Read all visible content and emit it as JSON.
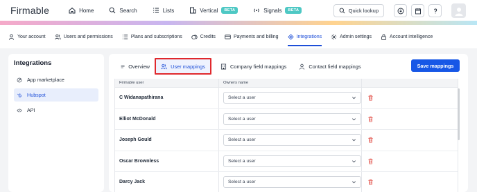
{
  "app": {
    "logo_text": "Firmable"
  },
  "topnav": {
    "items": [
      {
        "label": "Home",
        "icon": "home-icon"
      },
      {
        "label": "Search",
        "icon": "search-icon"
      },
      {
        "label": "Lists",
        "icon": "list-icon"
      },
      {
        "label": "Vertical",
        "icon": "building-icon",
        "badge": "BETA"
      },
      {
        "label": "Signals",
        "icon": "signal-icon",
        "badge": "BETA"
      }
    ],
    "quick_lookup": "Quick lookup"
  },
  "subnav": {
    "items": [
      {
        "label": "Your account",
        "icon": "user-icon"
      },
      {
        "label": "Users and permissions",
        "icon": "users-icon"
      },
      {
        "label": "Plans and subscriptions",
        "icon": "list-icon"
      },
      {
        "label": "Credits",
        "icon": "credits-icon"
      },
      {
        "label": "Payments and billing",
        "icon": "card-icon"
      },
      {
        "label": "Integrations",
        "icon": "integrations-icon",
        "active": true
      },
      {
        "label": "Admin settings",
        "icon": "gear-icon"
      },
      {
        "label": "Account intelligence",
        "icon": "lock-icon"
      }
    ]
  },
  "sidebar": {
    "title": "Integrations",
    "items": [
      {
        "label": "App marketplace",
        "icon": "marketplace-icon"
      },
      {
        "label": "Hubspot",
        "icon": "hubspot-icon",
        "active": true
      },
      {
        "label": "API",
        "icon": "code-icon"
      }
    ]
  },
  "panel": {
    "tabs": [
      {
        "label": "Overview",
        "icon": "overview-icon"
      },
      {
        "label": "User mappings",
        "icon": "users-icon",
        "active": true
      },
      {
        "label": "Company field mappings",
        "icon": "building-icon"
      },
      {
        "label": "Contact field mappings",
        "icon": "user-icon"
      }
    ],
    "save_label": "Save mappings"
  },
  "table": {
    "headers": {
      "user": "Firmable user",
      "owner": "Owners name"
    },
    "select_placeholder": "Select a user",
    "rows": [
      {
        "user": "C Widanapathirana"
      },
      {
        "user": "Elliot McDonald"
      },
      {
        "user": "Joseph Gould"
      },
      {
        "user": "Oscar Brownless"
      },
      {
        "user": "Darcy Jack"
      }
    ]
  },
  "colors": {
    "accent": "#1757e6",
    "highlight_border": "#e0282d",
    "beta": "#4ec8c4",
    "delete": "#e0473f"
  }
}
